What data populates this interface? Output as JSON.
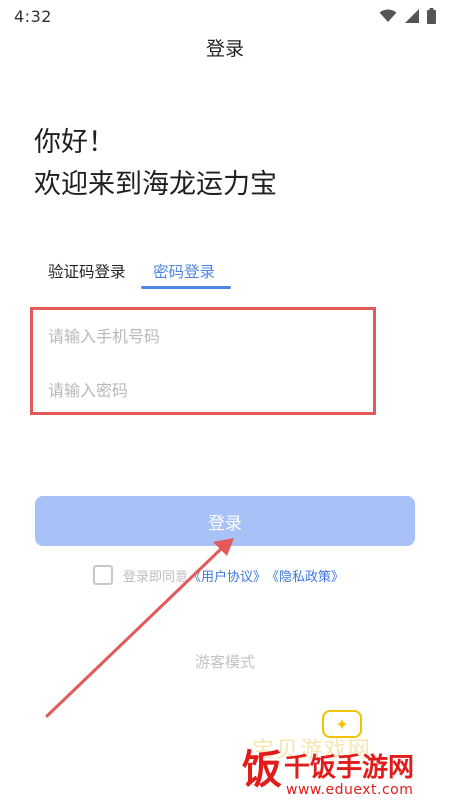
{
  "status": {
    "time": "4:32"
  },
  "header": {
    "title": "登录"
  },
  "greeting": {
    "line1": "你好！",
    "line2": "欢迎来到海龙运力宝"
  },
  "tabs": [
    {
      "label": "验证码登录",
      "active": false
    },
    {
      "label": "密码登录",
      "active": true
    }
  ],
  "form": {
    "phone_placeholder": "请输入手机号码",
    "password_placeholder": "请输入密码",
    "phone_value": "",
    "password_value": ""
  },
  "login_button": {
    "label": "登录"
  },
  "agreement": {
    "text": "登录即同意",
    "user_agreement": "《用户协议》",
    "privacy_policy": "《隐私政策》",
    "checked": false
  },
  "guest_mode": {
    "label": "游客模式"
  },
  "watermark": {
    "faint_text": "宝贝游戏网",
    "big_char": "饭",
    "title": "千饭手游网",
    "url": "www.eduext.com"
  },
  "colors": {
    "accent": "#4e85e0",
    "button_bg": "#a8c2f7",
    "highlight_red": "#e25a5a",
    "link": "#3d77df"
  }
}
